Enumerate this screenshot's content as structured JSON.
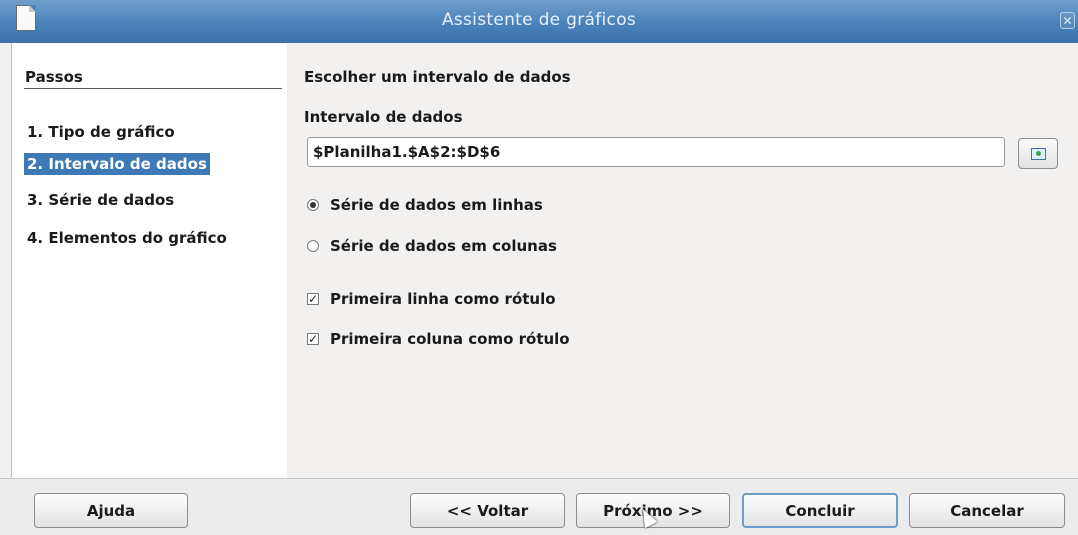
{
  "window": {
    "title": "Assistente de gráficos",
    "close_glyph": "✕"
  },
  "steps": {
    "heading": "Passos",
    "items": [
      {
        "label": "1. Tipo de gráfico",
        "active": false
      },
      {
        "label": "2. Intervalo de dados",
        "active": true
      },
      {
        "label": "3. Série de dados",
        "active": false
      },
      {
        "label": "4. Elementos do gráfico",
        "active": false
      }
    ]
  },
  "content": {
    "section_title": "Escolher um intervalo de dados",
    "range_label": "Intervalo de dados",
    "range_value": "$Planilha1.$A$2:$D$6",
    "options": {
      "rows": {
        "label": "Série de dados em linhas",
        "selected": true
      },
      "columns": {
        "label": "Série de dados em colunas",
        "selected": false
      },
      "first_row": {
        "label": "Primeira linha como rótulo",
        "checked": true
      },
      "first_column": {
        "label": "Primeira coluna como rótulo",
        "checked": true
      }
    }
  },
  "buttons": {
    "help": "Ajuda",
    "back": "<< Voltar",
    "next": "Próximo >>",
    "finish": "Concluir",
    "cancel": "Cancelar"
  },
  "icons": {
    "app": "document-icon",
    "close": "close-icon",
    "range_select": "shrink-dialog-icon",
    "cursor": "mouse-pointer-icon"
  },
  "colors": {
    "titlebar": "#4a82bb",
    "selection": "#3d79b4",
    "default_button_border": "#6f9bc9"
  }
}
